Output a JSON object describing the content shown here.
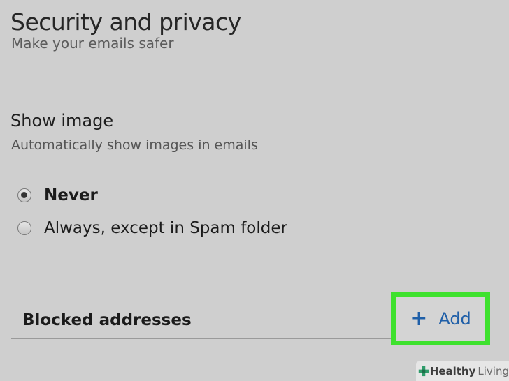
{
  "section": {
    "title": "Security and privacy",
    "subtitle": "Make your emails safer"
  },
  "show_image": {
    "title": "Show image",
    "description": "Automatically show images in emails",
    "options": [
      {
        "label": "Never",
        "selected": true
      },
      {
        "label": "Always, except in Spam folder",
        "selected": false
      }
    ]
  },
  "blocked": {
    "label": "Blocked addresses",
    "add_icon": "plus-icon",
    "add_label": "Add"
  },
  "watermark": {
    "icon": "plus-logo-icon",
    "text_strong": "Healthy",
    "text_light": "Living"
  },
  "colors": {
    "background": "#cfcfcf",
    "link_blue": "#1f5fa8",
    "highlight_green": "#3ee12e"
  }
}
